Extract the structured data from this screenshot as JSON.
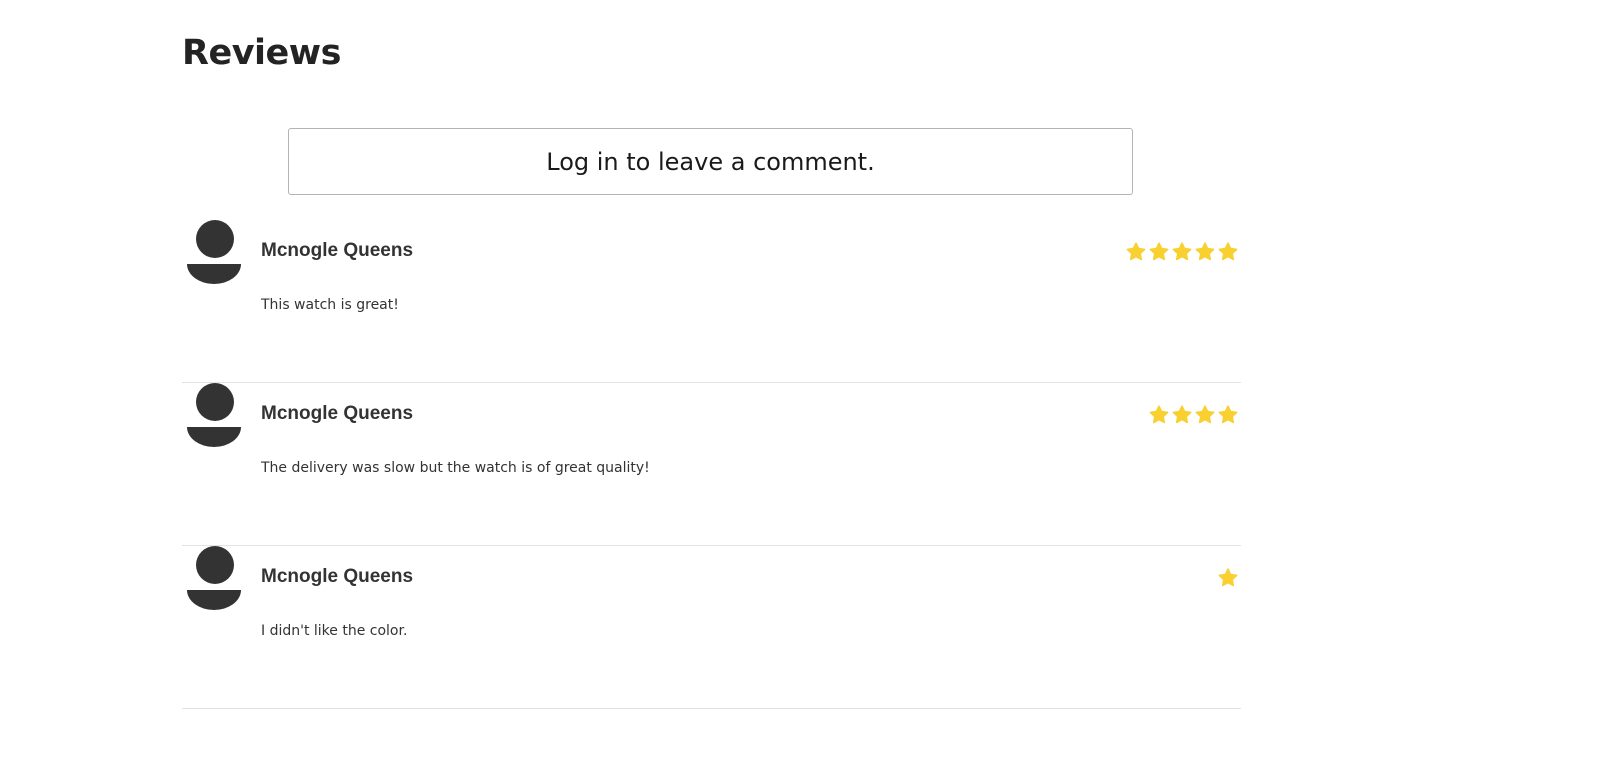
{
  "header": {
    "title": "Reviews"
  },
  "login_prompt": {
    "label": "Log in to leave a comment."
  },
  "colors": {
    "star": "#F8D030",
    "avatar": "#333333",
    "divider": "#E2E2E2"
  },
  "reviews": [
    {
      "name": "Mcnogle Queens",
      "rating": 5,
      "text": "This watch is great!"
    },
    {
      "name": "Mcnogle Queens",
      "rating": 4,
      "text": "The delivery was slow but the watch is of great quality!"
    },
    {
      "name": "Mcnogle Queens",
      "rating": 1,
      "text": "I didn't like the color."
    }
  ]
}
